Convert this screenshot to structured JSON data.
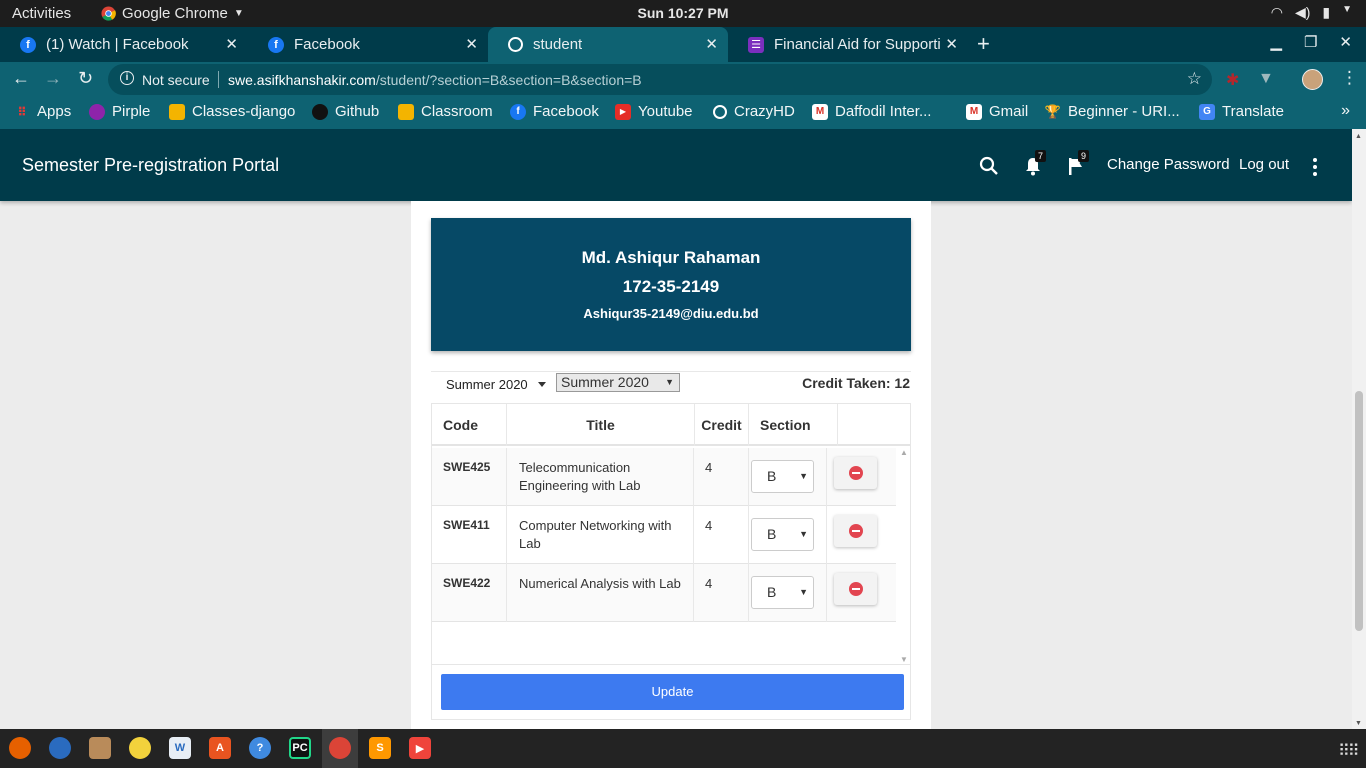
{
  "topbar": {
    "activities": "Activities",
    "app": "Google Chrome",
    "clock": "Sun 10:27 PM"
  },
  "tabs": [
    {
      "title": "(1) Watch | Facebook",
      "icon": "facebook-icon",
      "color": "#1877f2"
    },
    {
      "title": "Facebook",
      "icon": "facebook-icon",
      "color": "#1877f2"
    },
    {
      "title": "student",
      "icon": "globe-icon",
      "color": "#ffffff"
    },
    {
      "title": "Financial Aid for Supporti",
      "icon": "form-icon",
      "color": "#7b2fbe"
    }
  ],
  "omnibox": {
    "security": "Not secure",
    "host": "swe.asifkhanshakir.com",
    "path": "/student/?section=B&section=B&section=B"
  },
  "bookmarks": [
    {
      "label": "Apps",
      "color": "#e53935"
    },
    {
      "label": "Pirple",
      "color": "#8e24aa"
    },
    {
      "label": "Classes-django",
      "color": "#f4b400"
    },
    {
      "label": "Github",
      "color": "#111111"
    },
    {
      "label": "Classroom",
      "color": "#f4b400"
    },
    {
      "label": "Facebook",
      "color": "#1877f2"
    },
    {
      "label": "Youtube",
      "color": "#e52d27"
    },
    {
      "label": "CrazyHD",
      "color": "#ffffff"
    },
    {
      "label": "Daffodil Inter...",
      "color": "#d93025"
    },
    {
      "label": "Gmail",
      "color": "#d93025"
    },
    {
      "label": "Beginner - URI...",
      "color": "#e9b949"
    },
    {
      "label": "Translate",
      "color": "#4285f4"
    }
  ],
  "portal": {
    "title": "Semester Pre-registration Portal",
    "notifications": "7",
    "flags": "9",
    "change_password": "Change Password",
    "logout": "Log out"
  },
  "student": {
    "name": "Md. Ashiqur Rahaman",
    "id": "172-35-2149",
    "email": "Ashiqur35-2149@diu.edu.bd"
  },
  "semester": {
    "dropdown_label": "Summer 2020",
    "select_value": "Summer 2020",
    "credit_taken": "Credit Taken: 12"
  },
  "table": {
    "headers": {
      "code": "Code",
      "title": "Title",
      "credit": "Credit",
      "section": "Section"
    },
    "rows": [
      {
        "code": "SWE425",
        "title": "Telecommunication Engineering with Lab",
        "credit": "4",
        "section": "B"
      },
      {
        "code": "SWE411",
        "title": "Computer Networking with Lab",
        "credit": "4",
        "section": "B"
      },
      {
        "code": "SWE422",
        "title": "Numerical Analysis with Lab",
        "credit": "4",
        "section": "B"
      }
    ]
  },
  "update_button": "Update",
  "colors": {
    "appbar": "#003b4a",
    "profile": "#064966",
    "update": "#3d7af0",
    "delete": "#e24550"
  }
}
